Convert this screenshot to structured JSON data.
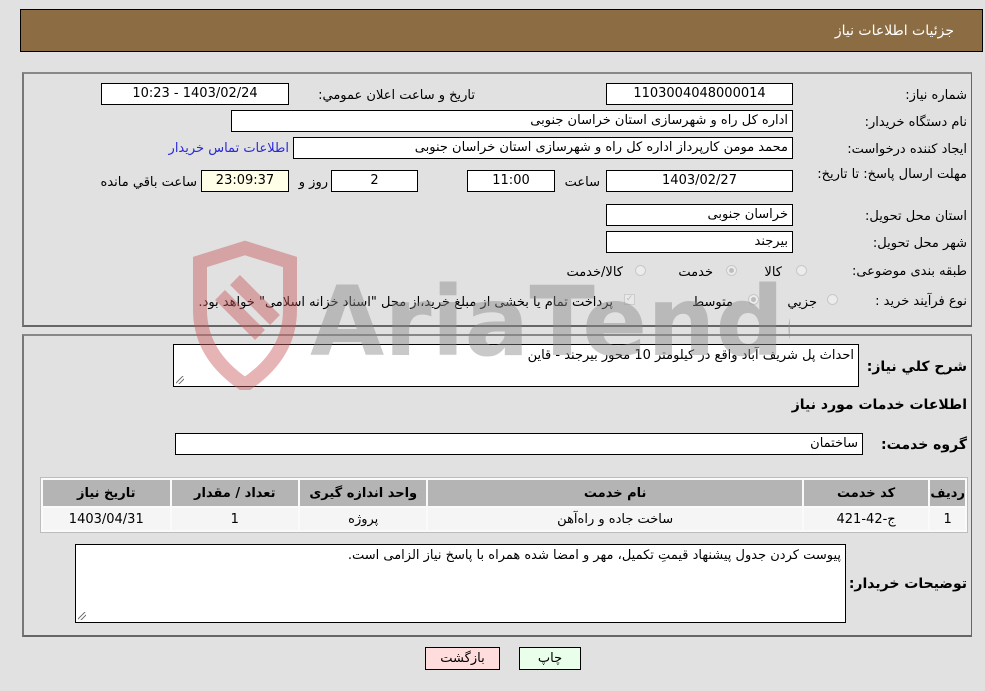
{
  "header": {
    "title": "جزئيات اطلاعات نياز"
  },
  "need_number": {
    "label": "شماره نياز:",
    "value": "1103004048000014"
  },
  "announce": {
    "label": "تاريخ و ساعت اعلان عمومي:",
    "value": "1403/02/24 - 10:23"
  },
  "buyer_org": {
    "label": "نام دستگاه خريدار:",
    "value": "اداره کل راه و شهرسازی استان خراسان جنوبی"
  },
  "requester": {
    "label": "ايجاد کننده درخواست:",
    "value": "محمد مومن کارپرداز اداره کل راه و شهرسازی استان خراسان جنوبی",
    "contact_link": "اطلاعات تماس خريدار"
  },
  "deadline": {
    "label": "مهلت ارسال پاسخ: تا تاريخ:",
    "date": "1403/02/27",
    "time_label": "ساعت",
    "time": "11:00",
    "days": "2",
    "days_label": "روز و",
    "remaining": "23:09:37",
    "remaining_label": "ساعت باقي مانده"
  },
  "province": {
    "label": "استان محل تحويل:",
    "value": "خراسان جنوبی"
  },
  "city": {
    "label": "شهر محل تحويل:",
    "value": "بيرجند"
  },
  "category": {
    "label": "طبقه بندی موضوعی:",
    "options": [
      "کالا",
      "خدمت",
      "کالا/خدمت"
    ],
    "selected": "خدمت"
  },
  "process": {
    "label": "نوع فرآيند خريد :",
    "options": [
      "جزيي",
      "متوسط"
    ],
    "selected": "متوسط",
    "treasury_checked": true,
    "treasury_note": "پرداخت تمام يا بخشی از مبلغ خريد،از محل \"اسناد خزانه اسلامی\" خواهد بود."
  },
  "description": {
    "label": "شرح کلي نياز:",
    "value": "احداث پل شريف آباد واقع در کيلومتر 10 محور بيرجند - قاين"
  },
  "services_title": "اطلاعات خدمات مورد نياز",
  "service_group": {
    "label": "گروه خدمت:",
    "value": "ساختمان"
  },
  "table": {
    "headers": [
      "رديف",
      "کد خدمت",
      "نام خدمت",
      "واحد اندازه گيری",
      "تعداد / مقدار",
      "تاريخ نياز"
    ],
    "rows": [
      [
        "1",
        "ج-42-421",
        "ساخت جاده و راه‌آهن",
        "پروژه",
        "1",
        "1403/04/31"
      ]
    ]
  },
  "buyer_notes": {
    "label": "توضيحات خريدار:",
    "value": "پيوست کردن جدول پيشنهاد قيمتِ تکميل، مهر و امضا شده همراه با پاسخ نياز الزامی است."
  },
  "buttons": {
    "print": "چاپ",
    "back": "بازگشت"
  },
  "watermark": {
    "text": "AriaTender.neT",
    "logo_color": "#d9a0a0"
  }
}
